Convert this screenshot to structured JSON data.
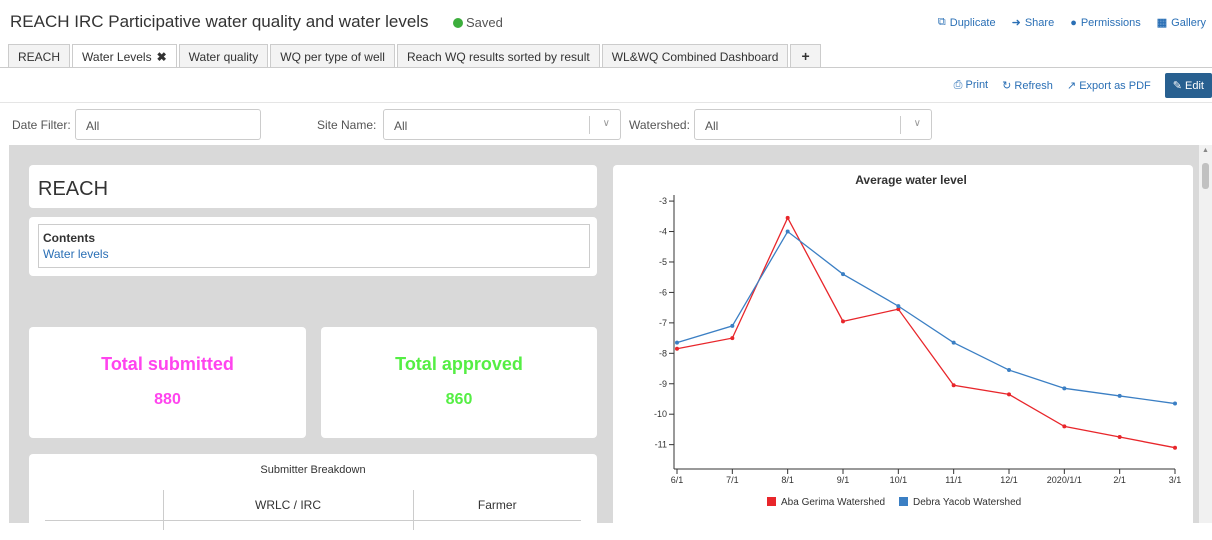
{
  "header": {
    "title": "REACH IRC Participative water quality and water levels",
    "saved": "Saved",
    "links": [
      "Duplicate",
      "Share",
      "Permissions",
      "Gallery"
    ]
  },
  "tabs": [
    {
      "label": "REACH"
    },
    {
      "label": "Water Levels",
      "active": true
    },
    {
      "label": "Water quality"
    },
    {
      "label": "WQ per type of well"
    },
    {
      "label": "Reach WQ results sorted by result"
    },
    {
      "label": "WL&WQ Combined Dashboard"
    }
  ],
  "actions": {
    "print": "Print",
    "refresh": "Refresh",
    "export": "Export as PDF",
    "edit": "Edit"
  },
  "filters": {
    "date": {
      "label": "Date Filter:",
      "value": "All"
    },
    "site": {
      "label": "Site Name:",
      "value": "All"
    },
    "watershed": {
      "label": "Watershed:",
      "value": "All"
    }
  },
  "dashboard": {
    "heading": "REACH",
    "contents_title": "Contents",
    "contents_link": "Water levels",
    "total_submitted": {
      "label": "Total submitted",
      "value": "880",
      "color": "#ff44ee"
    },
    "total_approved": {
      "label": "Total approved",
      "value": "860",
      "color": "#55ee44"
    },
    "breakdown_title": "Submitter Breakdown",
    "breakdown_columns": [
      "",
      "WRLC / IRC",
      "Farmer"
    ]
  },
  "chart_data": {
    "type": "line",
    "title": "Average water level",
    "categories": [
      "6/1",
      "7/1",
      "8/1",
      "9/1",
      "10/1",
      "11/1",
      "12/1",
      "2020/1/1",
      "2/1",
      "3/1"
    ],
    "ylim": [
      -11.8,
      -2.8
    ],
    "yticks": [
      -3,
      -4,
      -5,
      -6,
      -7,
      -8,
      -9,
      -10,
      -11
    ],
    "series": [
      {
        "name": "Aba Gerima Watershed",
        "color": "#e8262b",
        "values": [
          -7.85,
          -7.5,
          -3.55,
          -6.95,
          -6.55,
          -9.05,
          -9.35,
          -10.4,
          -10.75,
          -11.1
        ]
      },
      {
        "name": "Debra Yacob Watershed",
        "color": "#3b7fc4",
        "values": [
          -7.65,
          -7.1,
          -4.0,
          -5.4,
          -6.45,
          -7.65,
          -8.55,
          -9.15,
          -9.4,
          -9.65
        ]
      }
    ]
  }
}
